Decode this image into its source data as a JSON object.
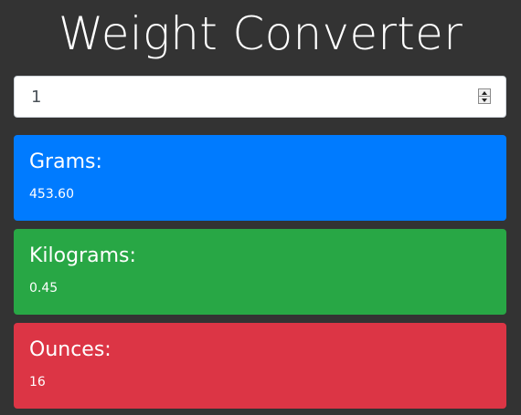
{
  "title": "Weight Converter",
  "input": {
    "value": "1"
  },
  "cards": [
    {
      "label": "Grams:",
      "value": "453.60",
      "color": "#007bff"
    },
    {
      "label": "Kilograms:",
      "value": "0.45",
      "color": "#28a745"
    },
    {
      "label": "Ounces:",
      "value": "16",
      "color": "#dc3545"
    }
  ],
  "icons": {
    "spinner_up": "chevron-up-icon",
    "spinner_down": "chevron-down-icon"
  }
}
